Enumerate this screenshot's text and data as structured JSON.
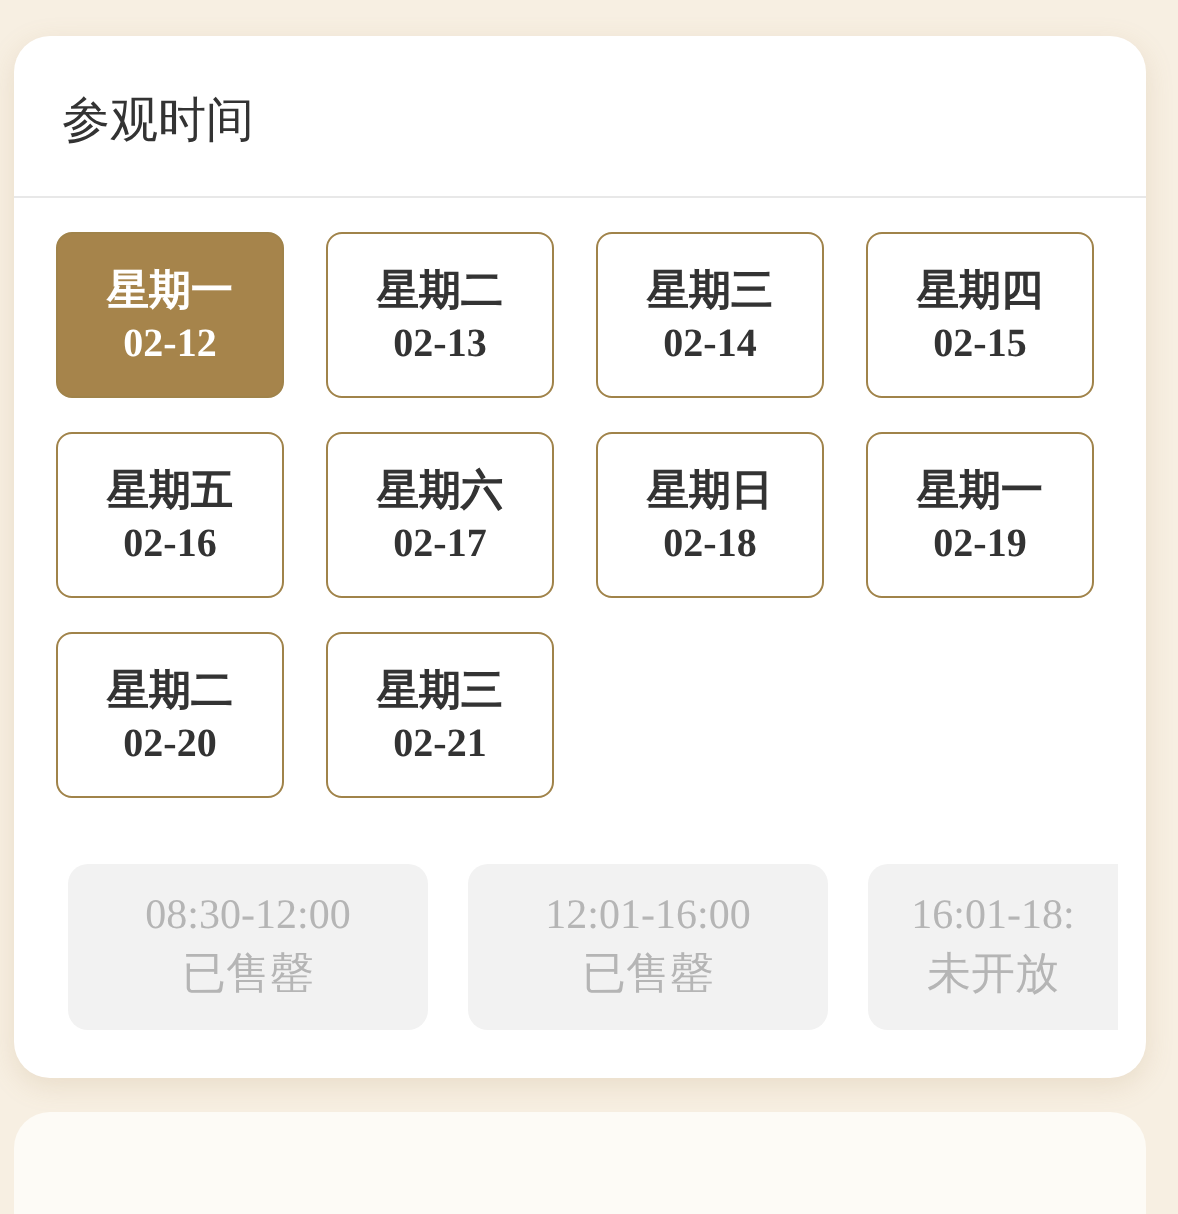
{
  "visit_card": {
    "title": "参观时间",
    "dates": [
      {
        "weekday": "星期一",
        "date": "02-12",
        "selected": true
      },
      {
        "weekday": "星期二",
        "date": "02-13",
        "selected": false
      },
      {
        "weekday": "星期三",
        "date": "02-14",
        "selected": false
      },
      {
        "weekday": "星期四",
        "date": "02-15",
        "selected": false
      },
      {
        "weekday": "星期五",
        "date": "02-16",
        "selected": false
      },
      {
        "weekday": "星期六",
        "date": "02-17",
        "selected": false
      },
      {
        "weekday": "星期日",
        "date": "02-18",
        "selected": false
      },
      {
        "weekday": "星期一",
        "date": "02-19",
        "selected": false
      },
      {
        "weekday": "星期二",
        "date": "02-20",
        "selected": false
      },
      {
        "weekday": "星期三",
        "date": "02-21",
        "selected": false
      }
    ],
    "time_slots": [
      {
        "time": "08:30-12:00",
        "status": "已售罄",
        "disabled": true
      },
      {
        "time": "12:01-16:00",
        "status": "已售罄",
        "disabled": true
      },
      {
        "time": "16:01-18:",
        "status": "未开放",
        "disabled": true
      }
    ]
  }
}
